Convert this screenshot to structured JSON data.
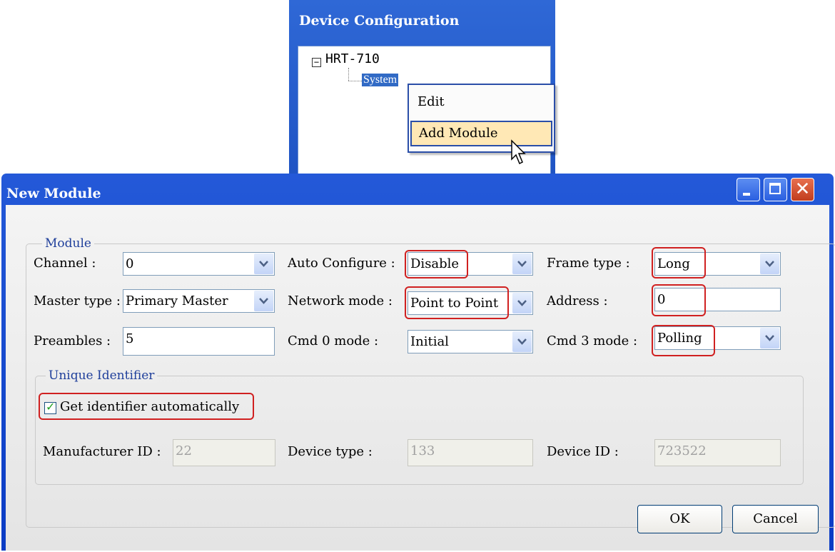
{
  "device_config": {
    "title": "Device Configuration",
    "tree": {
      "expander": "−",
      "root": "HRT-710",
      "child": "System"
    },
    "context_menu": [
      "Edit",
      "Add Module"
    ]
  },
  "dialog": {
    "title": "New Module",
    "module_group": {
      "legend": "Module",
      "channel_label": "Channel :",
      "channel_value": "0",
      "auto_configure_label": "Auto Configure :",
      "auto_configure_value": "Disable",
      "frame_type_label": "Frame type :",
      "frame_type_value": "Long",
      "master_type_label": "Master type :",
      "master_type_value": "Primary Master",
      "network_mode_label": "Network mode :",
      "network_mode_value": "Point to Point",
      "address_label": "Address :",
      "address_value": "0",
      "preambles_label": "Preambles :",
      "preambles_value": "5",
      "cmd0_mode_label": "Cmd 0 mode :",
      "cmd0_mode_value": "Initial",
      "cmd3_mode_label": "Cmd 3 mode :",
      "cmd3_mode_value": "Polling"
    },
    "uid_group": {
      "legend": "Unique Identifier",
      "auto_checkbox_label": "Get identifier automatically",
      "auto_checkbox_checked": true,
      "manufacturer_id_label": "Manufacturer ID :",
      "manufacturer_id_value": "22",
      "device_type_label": "Device type :",
      "device_type_value": "133",
      "device_id_label": "Device ID :",
      "device_id_value": "723522"
    },
    "ok_label": "OK",
    "cancel_label": "Cancel"
  },
  "colors": {
    "titlebar": "#0a3bc4",
    "highlight": "#d02020",
    "menu_hover": "#ffe8b5",
    "tree_selection": "#316ac5"
  }
}
